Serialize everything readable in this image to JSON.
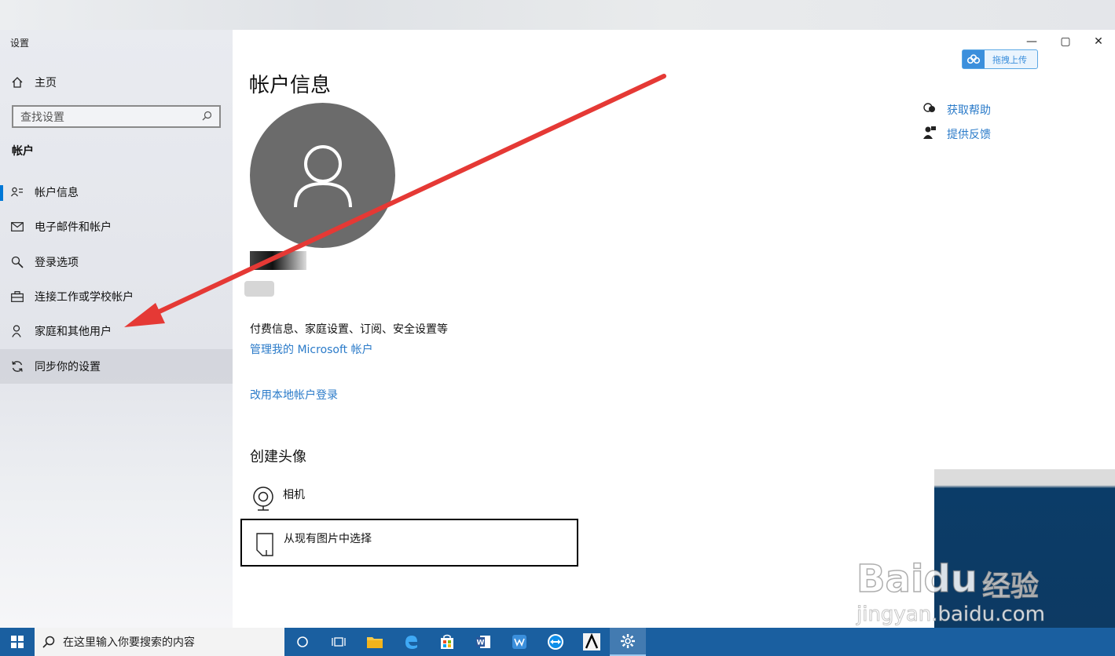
{
  "window": {
    "app_title": "设置",
    "minimize_glyph": "—",
    "maximize_glyph": "▢",
    "close_glyph": "✕"
  },
  "sidebar": {
    "home_label": "主页",
    "search_placeholder": "查找设置",
    "section_label": "帐户",
    "items": [
      {
        "label": "帐户信息",
        "icon": "account-info-icon",
        "active": true
      },
      {
        "label": "电子邮件和帐户",
        "icon": "mail-icon"
      },
      {
        "label": "登录选项",
        "icon": "key-icon"
      },
      {
        "label": "连接工作或学校帐户",
        "icon": "briefcase-icon"
      },
      {
        "label": "家庭和其他用户",
        "icon": "person-icon"
      },
      {
        "label": "同步你的设置",
        "icon": "sync-icon"
      }
    ]
  },
  "upload": {
    "label": "拖拽上传"
  },
  "main": {
    "title": "帐户信息",
    "info_text": "付费信息、家庭设置、订阅、安全设置等",
    "manage_link": "管理我的 Microsoft 帐户",
    "local_link": "改用本地帐户登录",
    "create_avatar_heading": "创建头像",
    "camera_label": "相机",
    "browse_label": "从现有图片中选择"
  },
  "help": {
    "get_help": "获取帮助",
    "feedback": "提供反馈"
  },
  "watermark": {
    "brand": "Bai",
    "brand_du": "du",
    "jingyan": "经验",
    "url": "jingyan.baidu.com"
  },
  "taskbar": {
    "search_placeholder": "在这里输入你要搜索的内容"
  },
  "colors": {
    "link": "#2b7bc9",
    "taskbar": "#1a5fa0",
    "arrow": "#e53935",
    "avatar": "#6b6b6b"
  }
}
